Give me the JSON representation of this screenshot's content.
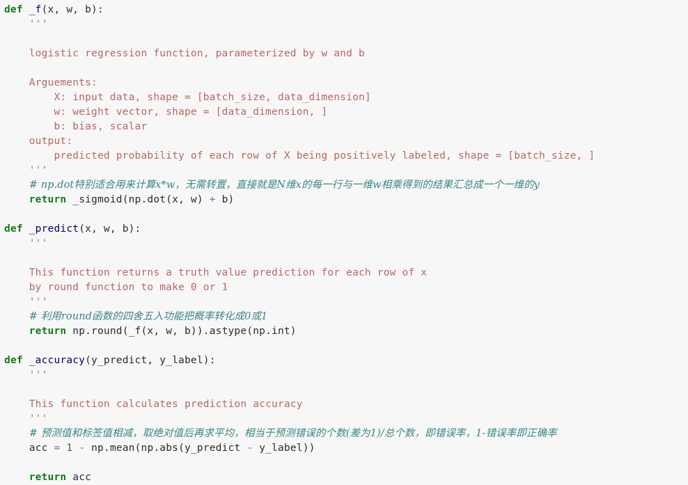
{
  "editor": {
    "background": "#f7f7f7",
    "language": "python",
    "colors": {
      "keyword": "#157a15",
      "function_name": "#00006e",
      "string": "#bb6565",
      "comment": "#3c8585",
      "operator": "#9a4fb8",
      "number": "#157a15",
      "plain": "#2b2b2b"
    }
  },
  "code_lines": [
    {
      "id": "l1",
      "tokens": [
        {
          "t": "kw",
          "v": "def"
        },
        {
          "t": "plain",
          "v": " "
        },
        {
          "t": "fn",
          "v": "_f"
        },
        {
          "t": "plain",
          "v": "(x, w, b):"
        }
      ]
    },
    {
      "id": "l2",
      "tokens": [
        {
          "t": "plain",
          "v": "    "
        },
        {
          "t": "str",
          "v": "'''"
        }
      ]
    },
    {
      "id": "l3",
      "tokens": [
        {
          "t": "str",
          "v": "    "
        }
      ]
    },
    {
      "id": "l4",
      "tokens": [
        {
          "t": "str",
          "v": "    logistic regression function, parameterized by w and b"
        }
      ]
    },
    {
      "id": "l5",
      "tokens": [
        {
          "t": "str",
          "v": "    "
        }
      ]
    },
    {
      "id": "l6",
      "tokens": [
        {
          "t": "str",
          "v": "    Arguements:"
        }
      ]
    },
    {
      "id": "l7",
      "tokens": [
        {
          "t": "str",
          "v": "        X: input data, shape = [batch_size, data_dimension]"
        }
      ]
    },
    {
      "id": "l8",
      "tokens": [
        {
          "t": "str",
          "v": "        w: weight vector, shape = [data_dimension, ]"
        }
      ]
    },
    {
      "id": "l9",
      "tokens": [
        {
          "t": "str",
          "v": "        b: bias, scalar"
        }
      ]
    },
    {
      "id": "l10",
      "tokens": [
        {
          "t": "str",
          "v": "    output:"
        }
      ]
    },
    {
      "id": "l11",
      "tokens": [
        {
          "t": "str",
          "v": "        predicted probability of each row of X being positively labeled, shape = [batch_size, ]"
        }
      ]
    },
    {
      "id": "l12",
      "tokens": [
        {
          "t": "str",
          "v": "    '''"
        }
      ]
    },
    {
      "id": "l13",
      "tokens": [
        {
          "t": "plain",
          "v": "    "
        },
        {
          "t": "cmt",
          "v": "# np.dot特别适合用来计算x*w，无需转置，直接就是N维x的每一行与一维w相乘得到的结果汇总成一个一维的y"
        }
      ]
    },
    {
      "id": "l14",
      "tokens": [
        {
          "t": "plain",
          "v": "    "
        },
        {
          "t": "kw",
          "v": "return"
        },
        {
          "t": "plain",
          "v": " _sigmoid(np.dot(x, w) "
        },
        {
          "t": "op",
          "v": "+"
        },
        {
          "t": "plain",
          "v": " b)"
        }
      ]
    },
    {
      "id": "l15",
      "tokens": []
    },
    {
      "id": "l16",
      "tokens": [
        {
          "t": "kw",
          "v": "def"
        },
        {
          "t": "plain",
          "v": " "
        },
        {
          "t": "fn",
          "v": "_predict"
        },
        {
          "t": "plain",
          "v": "(x, w, b):"
        }
      ]
    },
    {
      "id": "l17",
      "tokens": [
        {
          "t": "plain",
          "v": "    "
        },
        {
          "t": "str",
          "v": "'''"
        }
      ]
    },
    {
      "id": "l18",
      "tokens": [
        {
          "t": "str",
          "v": "    "
        }
      ]
    },
    {
      "id": "l19",
      "tokens": [
        {
          "t": "str",
          "v": "    This function returns a truth value prediction for each row of x"
        }
      ]
    },
    {
      "id": "l20",
      "tokens": [
        {
          "t": "str",
          "v": "    by round function to make 0 or 1"
        }
      ]
    },
    {
      "id": "l21",
      "tokens": [
        {
          "t": "str",
          "v": "    '''"
        }
      ]
    },
    {
      "id": "l22",
      "tokens": [
        {
          "t": "plain",
          "v": "    "
        },
        {
          "t": "cmt",
          "v": "# 利用round函数的四舍五入功能把概率转化成0或1"
        }
      ]
    },
    {
      "id": "l23",
      "tokens": [
        {
          "t": "plain",
          "v": "    "
        },
        {
          "t": "kw",
          "v": "return"
        },
        {
          "t": "plain",
          "v": " np.round(_f(x, w, b)).astype(np.int)"
        }
      ]
    },
    {
      "id": "l24",
      "tokens": []
    },
    {
      "id": "l25",
      "tokens": [
        {
          "t": "kw",
          "v": "def"
        },
        {
          "t": "plain",
          "v": " "
        },
        {
          "t": "fn",
          "v": "_accuracy"
        },
        {
          "t": "plain",
          "v": "(y_predict, y_label):"
        }
      ]
    },
    {
      "id": "l26",
      "tokens": [
        {
          "t": "plain",
          "v": "    "
        },
        {
          "t": "str",
          "v": "'''"
        }
      ]
    },
    {
      "id": "l27",
      "tokens": [
        {
          "t": "str",
          "v": "    "
        }
      ]
    },
    {
      "id": "l28",
      "tokens": [
        {
          "t": "str",
          "v": "    This function calculates prediction accuracy"
        }
      ]
    },
    {
      "id": "l29",
      "tokens": [
        {
          "t": "str",
          "v": "    '''"
        }
      ]
    },
    {
      "id": "l30",
      "tokens": [
        {
          "t": "plain",
          "v": "    "
        },
        {
          "t": "cmt",
          "v": "# 预测值和标签值相减，取绝对值后再求平均，相当于预测错误的个数(差为1)/总个数，即错误率，1-错误率即正确率"
        }
      ]
    },
    {
      "id": "l31",
      "tokens": [
        {
          "t": "plain",
          "v": "    acc "
        },
        {
          "t": "op",
          "v": "="
        },
        {
          "t": "plain",
          "v": " "
        },
        {
          "t": "num",
          "v": "1"
        },
        {
          "t": "plain",
          "v": " "
        },
        {
          "t": "op",
          "v": "-"
        },
        {
          "t": "plain",
          "v": " np.mean(np.abs(y_predict "
        },
        {
          "t": "op",
          "v": "-"
        },
        {
          "t": "plain",
          "v": " y_label))"
        }
      ]
    },
    {
      "id": "l32",
      "tokens": []
    },
    {
      "id": "l33",
      "tokens": [
        {
          "t": "plain",
          "v": "    "
        },
        {
          "t": "kw",
          "v": "return"
        },
        {
          "t": "plain",
          "v": " acc"
        }
      ]
    }
  ]
}
